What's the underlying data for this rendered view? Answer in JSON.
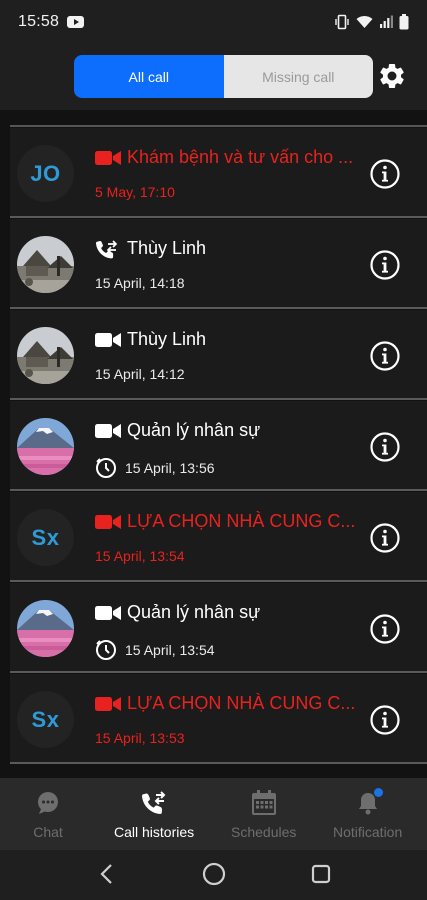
{
  "status_bar": {
    "time": "15:58"
  },
  "header": {
    "tabs": [
      {
        "label": "All call",
        "active": true
      },
      {
        "label": "Missing call",
        "active": false
      }
    ],
    "accent_color": "#0d6efd"
  },
  "calls": [
    {
      "avatar_text": "JO",
      "avatar_type": "initials",
      "call_type": "video-icon",
      "title": "Khám bệnh và tư vấn cho ...",
      "date": "5 May, 17:10",
      "missed": true,
      "scheduled": false
    },
    {
      "avatar_text": "",
      "avatar_type": "photo-temple",
      "call_type": "phone-icon",
      "title": "Thùy Linh",
      "date": "15 April, 14:18",
      "missed": false,
      "scheduled": false
    },
    {
      "avatar_text": "",
      "avatar_type": "photo-temple",
      "call_type": "video-icon",
      "title": "Thùy Linh",
      "date": "15 April, 14:12",
      "missed": false,
      "scheduled": false
    },
    {
      "avatar_text": "",
      "avatar_type": "photo-fuji",
      "call_type": "video-icon",
      "title": "Quản lý nhân sự",
      "date": "15 April, 13:56",
      "missed": false,
      "scheduled": true
    },
    {
      "avatar_text": "Sx",
      "avatar_type": "initials",
      "call_type": "video-icon",
      "title": "LỰA CHỌN NHÀ CUNG C...",
      "date": "15 April, 13:54",
      "missed": true,
      "scheduled": false
    },
    {
      "avatar_text": "",
      "avatar_type": "photo-fuji",
      "call_type": "video-icon",
      "title": "Quản lý nhân sự",
      "date": "15 April, 13:54",
      "missed": false,
      "scheduled": true
    },
    {
      "avatar_text": "Sx",
      "avatar_type": "initials",
      "call_type": "video-icon",
      "title": "LỰA CHỌN NHÀ CUNG C...",
      "date": "15 April, 13:53",
      "missed": true,
      "scheduled": false
    }
  ],
  "missed_color": "#e8221e",
  "bottom_nav": [
    {
      "label": "Chat",
      "icon": "chat-icon",
      "active": false
    },
    {
      "label": "Call histories",
      "icon": "call-history-icon",
      "active": true
    },
    {
      "label": "Schedules",
      "icon": "calendar-icon",
      "active": false
    },
    {
      "label": "Notification",
      "icon": "bell-icon",
      "active": false,
      "badge": true
    }
  ]
}
